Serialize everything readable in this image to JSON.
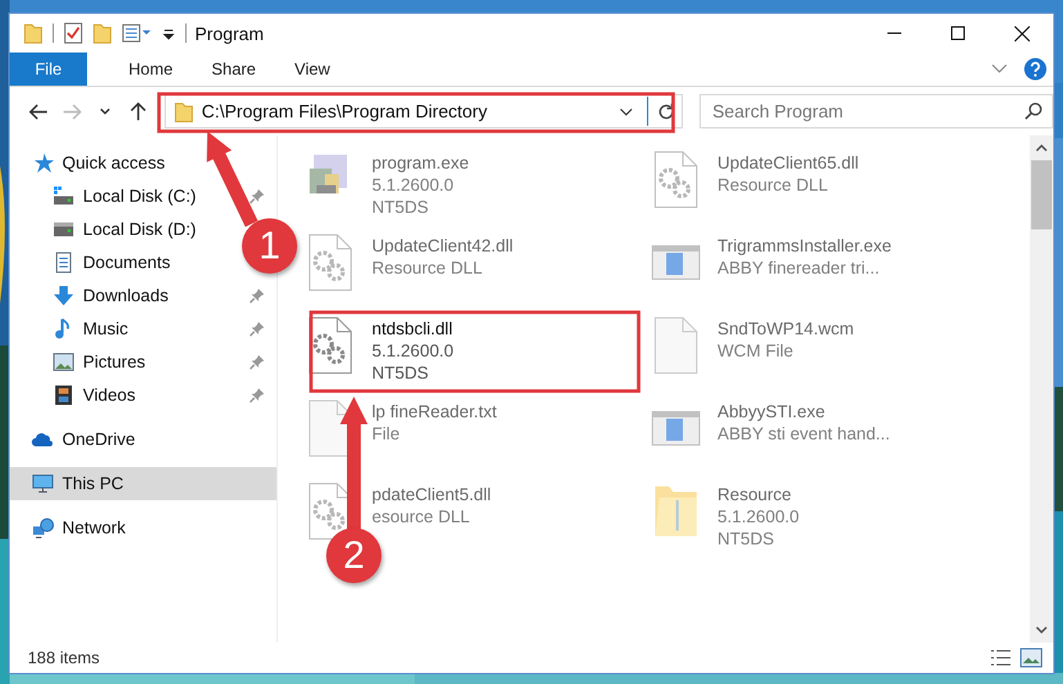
{
  "window": {
    "title": "Program"
  },
  "ribbon": {
    "tabs": [
      {
        "label": "File",
        "kind": "file"
      },
      {
        "label": "Home",
        "kind": "tab"
      },
      {
        "label": "Share",
        "kind": "tab"
      },
      {
        "label": "View",
        "kind": "tab"
      }
    ]
  },
  "nav_buttons": [
    {
      "kind": "back",
      "disabled": false
    },
    {
      "kind": "forward",
      "disabled": true
    },
    {
      "kind": "recent",
      "disabled": false
    },
    {
      "kind": "up",
      "disabled": false
    }
  ],
  "address": {
    "path": "C:\\Program Files\\Program Directory"
  },
  "search": {
    "placeholder": "Search Program"
  },
  "sidebar": {
    "items": [
      {
        "label": "Quick access",
        "kind": "star",
        "selected": false,
        "children": [
          {
            "label": "Local Disk (C:)",
            "kind": "disk-win",
            "pinned": true,
            "selected": false
          },
          {
            "label": "Local Disk (D:)",
            "kind": "disk",
            "pinned": false,
            "selected": false
          },
          {
            "label": "Documents",
            "kind": "document",
            "pinned": false,
            "selected": false
          },
          {
            "label": "Downloads",
            "kind": "download",
            "pinned": true,
            "selected": false
          },
          {
            "label": "Music",
            "kind": "music",
            "pinned": true,
            "selected": false
          },
          {
            "label": "Pictures",
            "kind": "pictures",
            "pinned": true,
            "selected": false
          },
          {
            "label": "Videos",
            "kind": "videos",
            "pinned": true,
            "selected": false
          }
        ]
      },
      {
        "label": "OneDrive",
        "kind": "cloud",
        "selected": false
      },
      {
        "label": "This PC",
        "kind": "pc",
        "selected": true
      },
      {
        "label": "Network",
        "kind": "network",
        "selected": false
      }
    ]
  },
  "files": [
    {
      "kind": "app",
      "blurred": true,
      "lines": [
        "program.exe",
        "5.1.2600.0",
        "NT5DS"
      ]
    },
    {
      "kind": "dll",
      "blurred": true,
      "lines": [
        "UpdateClient65.dll",
        "Resource DLL"
      ]
    },
    {
      "kind": "dll",
      "blurred": true,
      "lines": [
        "UpdateClient42.dll",
        "Resource DLL"
      ]
    },
    {
      "kind": "installer",
      "blurred": true,
      "lines": [
        "TrigrammsInstaller.exe",
        "ABBY finereader tri..."
      ]
    },
    {
      "kind": "dll",
      "blurred": false,
      "lines": [
        "ntdsbcli.dll",
        "5.1.2600.0",
        "NT5DS"
      ]
    },
    {
      "kind": "blank",
      "blurred": true,
      "lines": [
        "SndToWP14.wcm",
        "WCM File"
      ]
    },
    {
      "kind": "blank",
      "blurred": true,
      "lines": [
        "lp fineReader.txt",
        "File"
      ]
    },
    {
      "kind": "installer",
      "blurred": true,
      "lines": [
        "AbbyySTI.exe",
        "ABBY sti event hand..."
      ]
    },
    {
      "kind": "dll",
      "blurred": true,
      "lines": [
        "pdateClient5.dll",
        "esource DLL"
      ]
    },
    {
      "kind": "folder",
      "blurred": true,
      "lines": [
        "Resource",
        "5.1.2600.0",
        "NT5DS"
      ]
    }
  ],
  "annotations": [
    {
      "number": "1"
    },
    {
      "number": "2"
    }
  ],
  "status_bar": {
    "count": "188 items"
  }
}
